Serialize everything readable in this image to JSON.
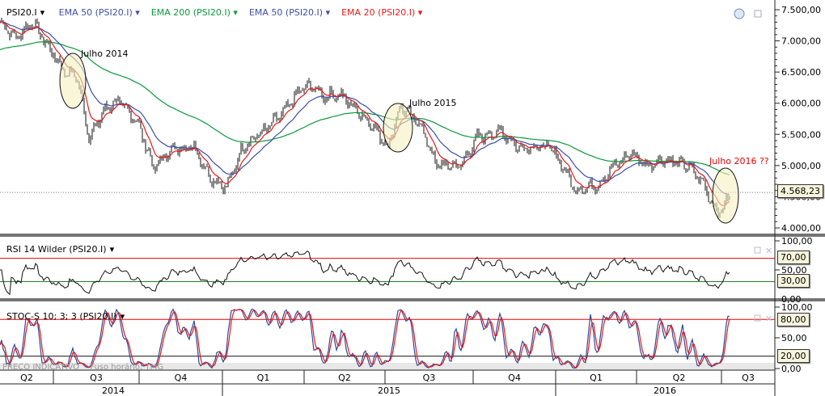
{
  "header": {
    "symbol": "PSI20.I",
    "indicators": [
      {
        "label": "EMA 50 (PSI20.I)",
        "color": "#3b4fa8"
      },
      {
        "label": "EMA 200 (PSI20.I)",
        "color": "#0a9a3c"
      },
      {
        "label": "EMA 50 (PSI20.I)",
        "color": "#3b4fa8"
      },
      {
        "label": "EMA 20 (PSI20.I)",
        "color": "#e8191c"
      }
    ]
  },
  "rsi_pane": {
    "title": "RSI 14 Wilder (PSI20.I)",
    "axis": [
      "100,00",
      "50,00",
      "0,00"
    ],
    "levels": [
      "70,00",
      "30,00"
    ]
  },
  "stoch_pane": {
    "title": "STOC-S 10; 3; 3 (PSI20.I)",
    "axis": [
      "100,00",
      "50,00",
      "0,00"
    ],
    "levels": [
      "80,00",
      "20,00"
    ]
  },
  "footer": {
    "watermark": "PREÇO INDICATIVO",
    "timezone": "Fuso horário: TMG"
  },
  "chart_data": {
    "type": "line",
    "title": "PSI20.I",
    "y_ticks": [
      "7.500,00",
      "7.000,00",
      "6.500,00",
      "6.000,00",
      "5.500,00",
      "5.000,00",
      "4.500,00",
      "4.000,00"
    ],
    "ylim": [
      4000,
      7500
    ],
    "last_value": "4.568,23",
    "quarters": [
      "Q2",
      "Q3",
      "Q4",
      "Q1",
      "Q2",
      "Q3",
      "Q4",
      "Q1",
      "Q2",
      "Q3"
    ],
    "years": [
      "2014",
      "2015",
      "2016"
    ],
    "annotations": [
      "Julho 2014",
      "Julho 2015",
      "Julho 2016 ??"
    ],
    "price_anchors": [
      [
        0,
        7300
      ],
      [
        20,
        7050
      ],
      [
        40,
        7300
      ],
      [
        60,
        6900
      ],
      [
        80,
        6500
      ],
      [
        95,
        6450
      ],
      [
        110,
        5450
      ],
      [
        130,
        5900
      ],
      [
        145,
        6050
      ],
      [
        170,
        5700
      ],
      [
        190,
        4950
      ],
      [
        210,
        5250
      ],
      [
        240,
        5300
      ],
      [
        260,
        4800
      ],
      [
        280,
        4650
      ],
      [
        300,
        5300
      ],
      [
        330,
        5600
      ],
      [
        350,
        5850
      ],
      [
        370,
        6200
      ],
      [
        385,
        6300
      ],
      [
        400,
        6100
      ],
      [
        420,
        6150
      ],
      [
        440,
        5900
      ],
      [
        460,
        5650
      ],
      [
        480,
        5300
      ],
      [
        495,
        5950
      ],
      [
        520,
        5650
      ],
      [
        540,
        5000
      ],
      [
        570,
        5000
      ],
      [
        590,
        5450
      ],
      [
        620,
        5550
      ],
      [
        640,
        5300
      ],
      [
        680,
        5300
      ],
      [
        700,
        4900
      ],
      [
        710,
        4600
      ],
      [
        740,
        4700
      ],
      [
        760,
        5000
      ],
      [
        780,
        5200
      ],
      [
        800,
        5000
      ],
      [
        820,
        5100
      ],
      [
        850,
        5000
      ],
      [
        870,
        4700
      ],
      [
        880,
        4400
      ],
      [
        890,
        4250
      ],
      [
        905,
        4568
      ]
    ]
  }
}
